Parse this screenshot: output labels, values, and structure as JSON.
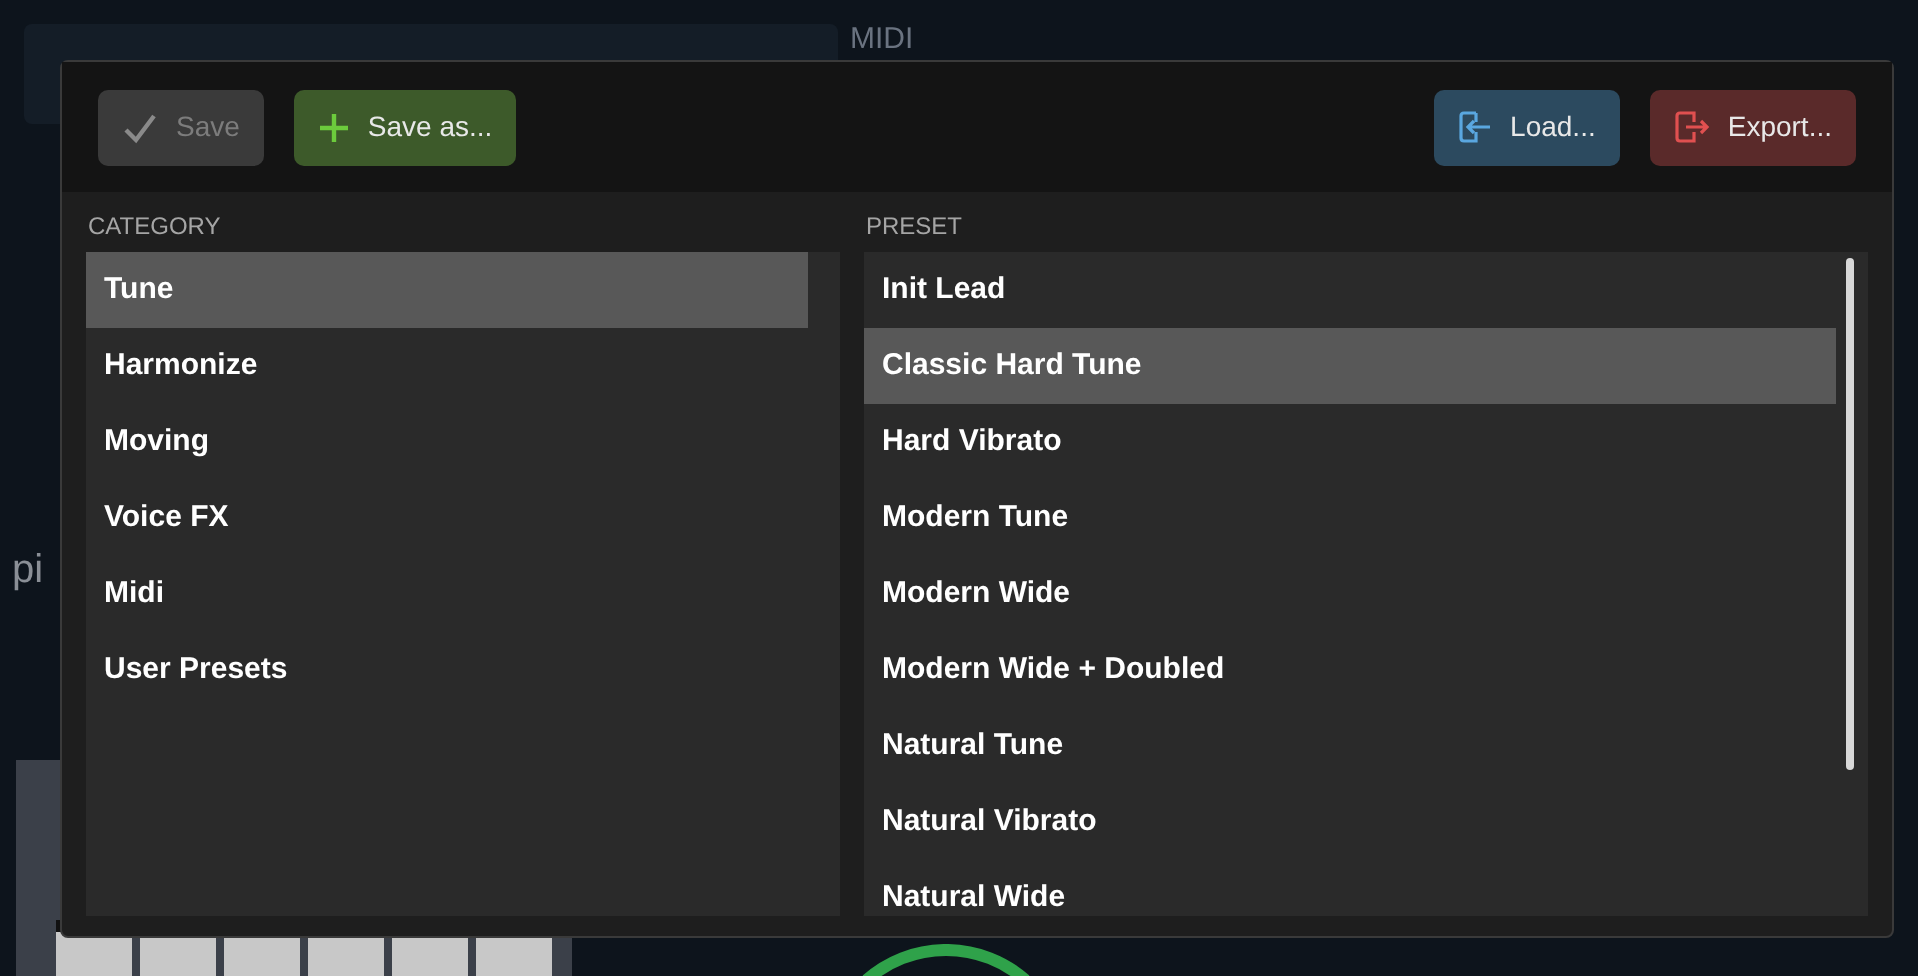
{
  "background": {
    "labels": [
      {
        "text": "MIDI"
      },
      {
        "text": "pi"
      }
    ]
  },
  "toolbar": {
    "buttons": [
      {
        "kind": "save",
        "label": "Save",
        "disabled": true
      },
      {
        "kind": "save_as",
        "label": "Save as...",
        "disabled": false
      },
      {
        "kind": "load",
        "label": "Load...",
        "disabled": false
      },
      {
        "kind": "export",
        "label": "Export...",
        "disabled": false
      }
    ]
  },
  "category": {
    "heading": "CATEGORY",
    "items": [
      {
        "label": "Tune",
        "selected": true
      },
      {
        "label": "Harmonize",
        "selected": false
      },
      {
        "label": "Moving",
        "selected": false
      },
      {
        "label": "Voice FX",
        "selected": false
      },
      {
        "label": "Midi",
        "selected": false
      },
      {
        "label": "User Presets",
        "selected": false
      }
    ]
  },
  "preset": {
    "heading": "PRESET",
    "items": [
      {
        "label": "Init Lead",
        "selected": false
      },
      {
        "label": "Classic Hard Tune",
        "selected": true
      },
      {
        "label": "Hard Vibrato",
        "selected": false
      },
      {
        "label": "Modern Tune",
        "selected": false
      },
      {
        "label": "Modern Wide",
        "selected": false
      },
      {
        "label": "Modern Wide + Doubled",
        "selected": false
      },
      {
        "label": "Natural Tune",
        "selected": false
      },
      {
        "label": "Natural Vibrato",
        "selected": false
      },
      {
        "label": "Natural Wide",
        "selected": false
      }
    ]
  }
}
